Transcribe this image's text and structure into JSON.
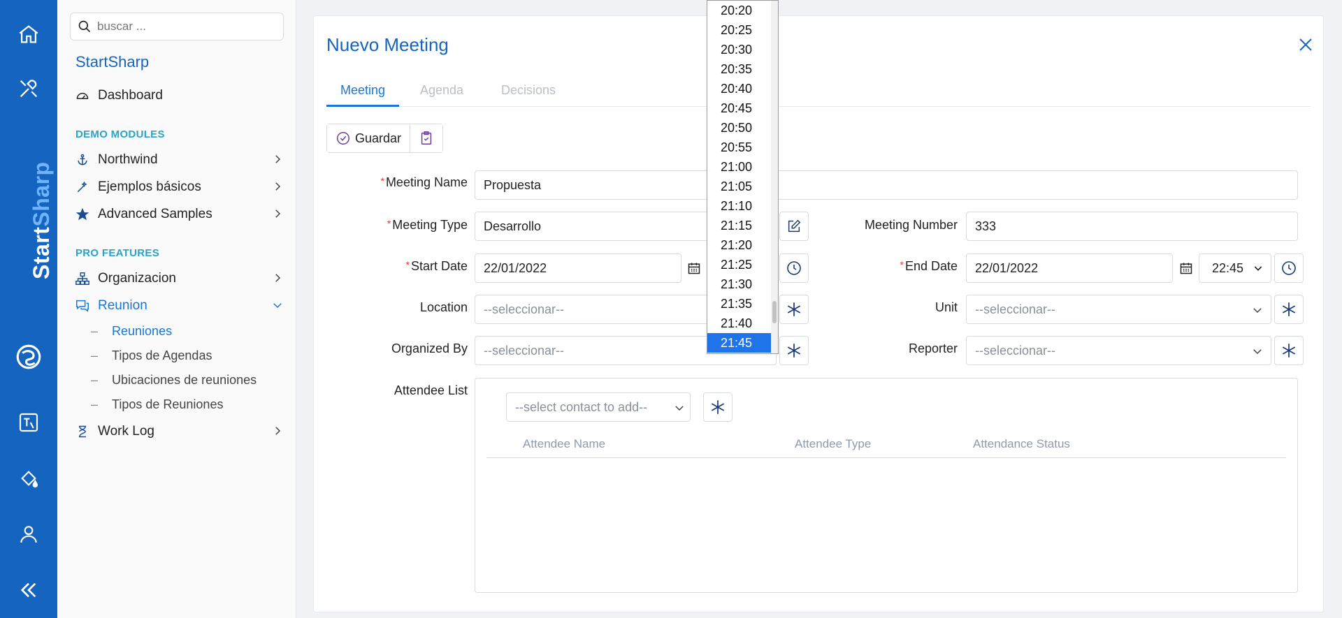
{
  "sidebar": {
    "search_placeholder": "buscar ...",
    "app_title": "StartSharp",
    "dashboard": "Dashboard",
    "section_demo": "DEMO MODULES",
    "northwind": "Northwind",
    "ejemplos": "Ejemplos básicos",
    "advanced": "Advanced Samples",
    "section_pro": "PRO FEATURES",
    "organizacion": "Organizacion",
    "reunion": "Reunion",
    "sub": [
      "Reuniones",
      "Tipos de Agendas",
      "Ubicaciones de reuniones",
      "Tipos de Reuniones"
    ],
    "worklog": "Work Log"
  },
  "rail": {
    "brand_a": "Start",
    "brand_b": "Sharp"
  },
  "dialog": {
    "title": "Nuevo Meeting",
    "tabs": [
      "Meeting",
      "Agenda",
      "Decisions"
    ],
    "save": "Guardar",
    "fields": {
      "meeting_name_label": "Meeting Name",
      "meeting_name": "Propuesta",
      "meeting_type_label": "Meeting Type",
      "meeting_type": "Desarrollo",
      "meeting_number_label": "Meeting Number",
      "meeting_number": "333",
      "start_date_label": "Start Date",
      "start_date": "22/01/2022",
      "end_date_label": "End Date",
      "end_date": "22/01/2022",
      "end_time": "22:45",
      "location_label": "Location",
      "location": "--seleccionar--",
      "unit_label": "Unit",
      "unit": "--seleccionar--",
      "organized_label": "Organized By",
      "organized": "--seleccionar--",
      "reporter_label": "Reporter",
      "reporter": "--seleccionar--",
      "attendee_label": "Attendee List",
      "contact_placeholder": "--select contact to add--",
      "col_name": "Attendee Name",
      "col_type": "Attendee Type",
      "col_status": "Attendance Status"
    }
  },
  "time_options": [
    "20:20",
    "20:25",
    "20:30",
    "20:35",
    "20:40",
    "20:45",
    "20:50",
    "20:55",
    "21:00",
    "21:05",
    "21:10",
    "21:15",
    "21:20",
    "21:25",
    "21:30",
    "21:35",
    "21:40",
    "21:45"
  ],
  "time_selected": "21:45",
  "colors": {
    "rail": "#1565c0",
    "accent": "#1976d2",
    "section": "#2aa3c5",
    "required": "#e53935"
  }
}
